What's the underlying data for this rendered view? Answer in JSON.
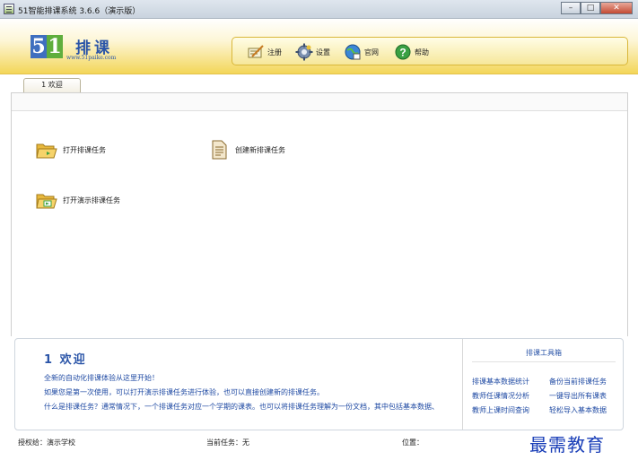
{
  "window": {
    "title": "51智能排课系统 3.6.6（演示版）",
    "minimize": "–",
    "maximize": "□",
    "close": "✕"
  },
  "logo": {
    "digit5": "5",
    "digit1": "1",
    "name": "排课",
    "url": "www.51paike.com"
  },
  "toolbar": [
    {
      "label": "注册",
      "icon": "register-icon"
    },
    {
      "label": "设置",
      "icon": "settings-gear-icon"
    },
    {
      "label": "官网",
      "icon": "website-globe-icon"
    },
    {
      "label": "帮助",
      "icon": "help-icon"
    }
  ],
  "tabs": [
    {
      "label": "1 欢迎"
    }
  ],
  "actions": {
    "open_task": "打开排课任务",
    "new_task": "创建新排课任务",
    "open_demo": "打开演示排课任务"
  },
  "welcome": {
    "title": "1 欢迎",
    "lines": [
      "全新的自动化排课体验从这里开始！",
      "如果您是第一次使用，可以打开演示排课任务进行体验，也可以直接创建新的排课任务。",
      "什么是排课任务？通常情况下，一个排课任务对应一个学期的课表。也可以将排课任务理解为一份文档，其中包括基本数据、"
    ]
  },
  "toolbox": {
    "title": "排课工具箱",
    "links": [
      "排课基本数据统计",
      "备份当前排课任务",
      "教师任课情况分析",
      "一键导出所有课表",
      "教师上课时间查询",
      "轻松导入基本数据"
    ]
  },
  "status": {
    "licensed_label": "授权给：演示学校",
    "current_task_label": "当前任务：无",
    "position_label": "位置："
  },
  "watermark": "最需教育",
  "colors": {
    "accent_blue": "#2b55a8",
    "header_yellow": "#f3d659"
  }
}
